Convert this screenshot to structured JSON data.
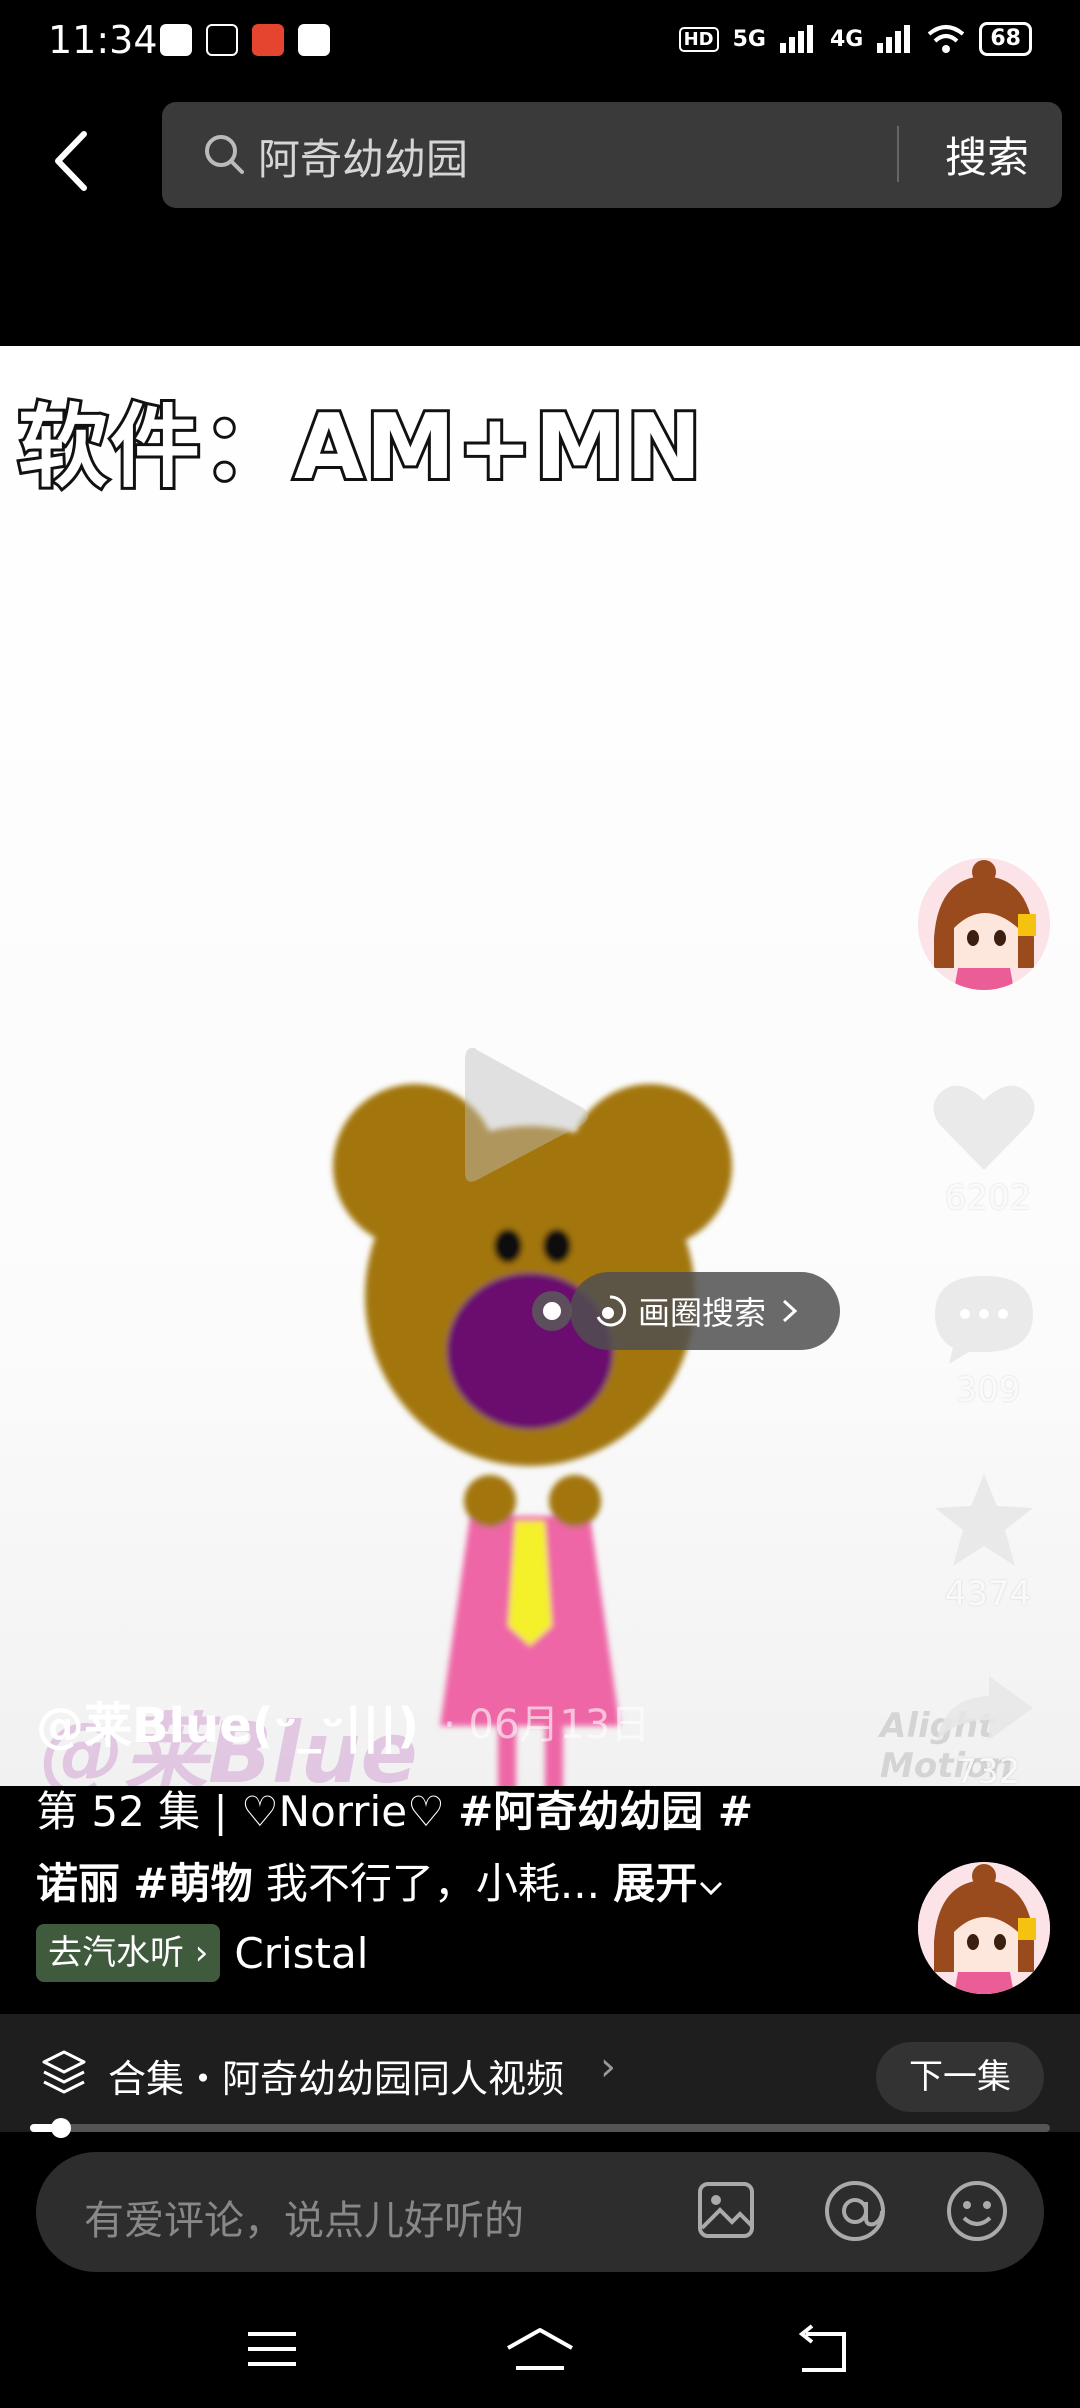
{
  "status_bar": {
    "time": "11:34",
    "network_1": "5G",
    "network_2": "4G",
    "battery": "68"
  },
  "search": {
    "query": "阿奇幼幼园",
    "button_label": "搜索"
  },
  "video": {
    "caption": "软件：AM+MN",
    "circle_search_label": "画圈搜索",
    "watermark": "@莱Blue",
    "brand_watermark": "Alight Motion"
  },
  "rail": {
    "likes": "6202",
    "comments": "309",
    "favorites": "4374",
    "shares": "732"
  },
  "post": {
    "author": "@莱Blue(ᵕ_ᵕ|||)",
    "date": "06月13日",
    "desc_plain_1": "第 52 集 | ♡Norrie♡ ",
    "tag_1": "#阿奇幼幼园",
    "desc_plain_2": " #",
    "desc_tag_cont": "诺丽",
    "tag_2": "#萌物",
    "desc_plain_3": " 我不行了，小耗...",
    "expand": "展开",
    "music_badge": "去汽水听",
    "music_name": "Cristal"
  },
  "collection": {
    "label": "合集・阿奇幼幼园同人视频",
    "next_label": "下一集"
  },
  "progress": {
    "fraction": 0.03
  },
  "comment": {
    "placeholder": "有爱评论，说点儿好听的"
  }
}
